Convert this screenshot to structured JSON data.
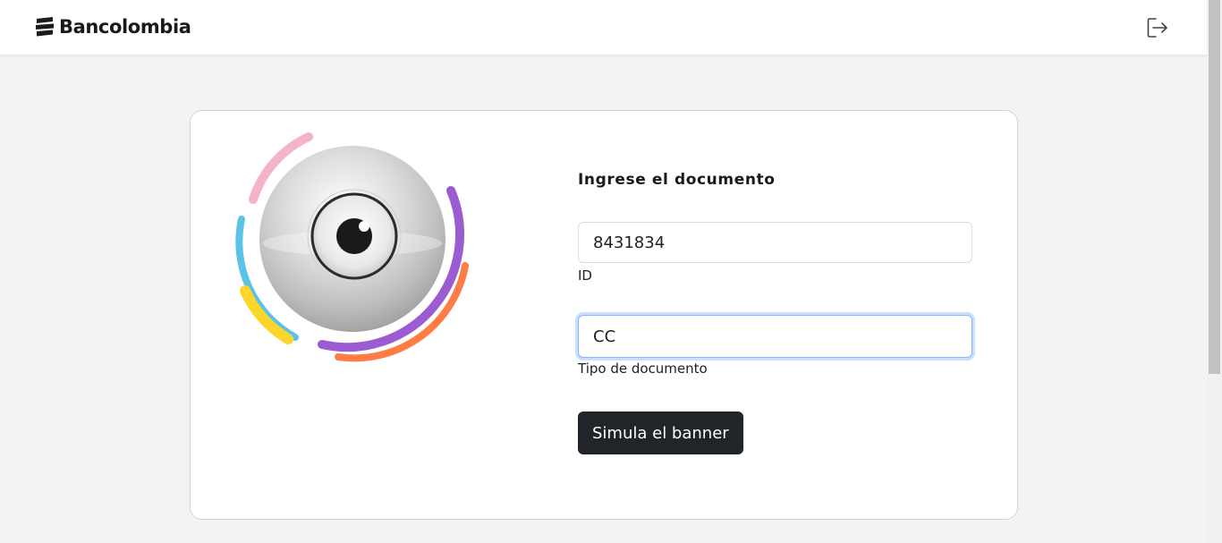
{
  "header": {
    "brand": "Bancolombia",
    "logout_icon": "logout-icon"
  },
  "illustration": {
    "icon": "eye-icon",
    "ring_colors": [
      "#f5b3cb",
      "#5bc4e6",
      "#fcd62b",
      "#9b5bd1",
      "#ff7c45"
    ]
  },
  "form": {
    "title": "Ingrese el documento",
    "id_value": "8431834",
    "id_label": "ID",
    "doc_type_value": "CC",
    "doc_type_label": "Tipo de documento",
    "submit_label": "Simula el banner"
  },
  "colors": {
    "background": "#f3f3f3",
    "button": "#212529",
    "focus_border": "#86b7fe"
  }
}
